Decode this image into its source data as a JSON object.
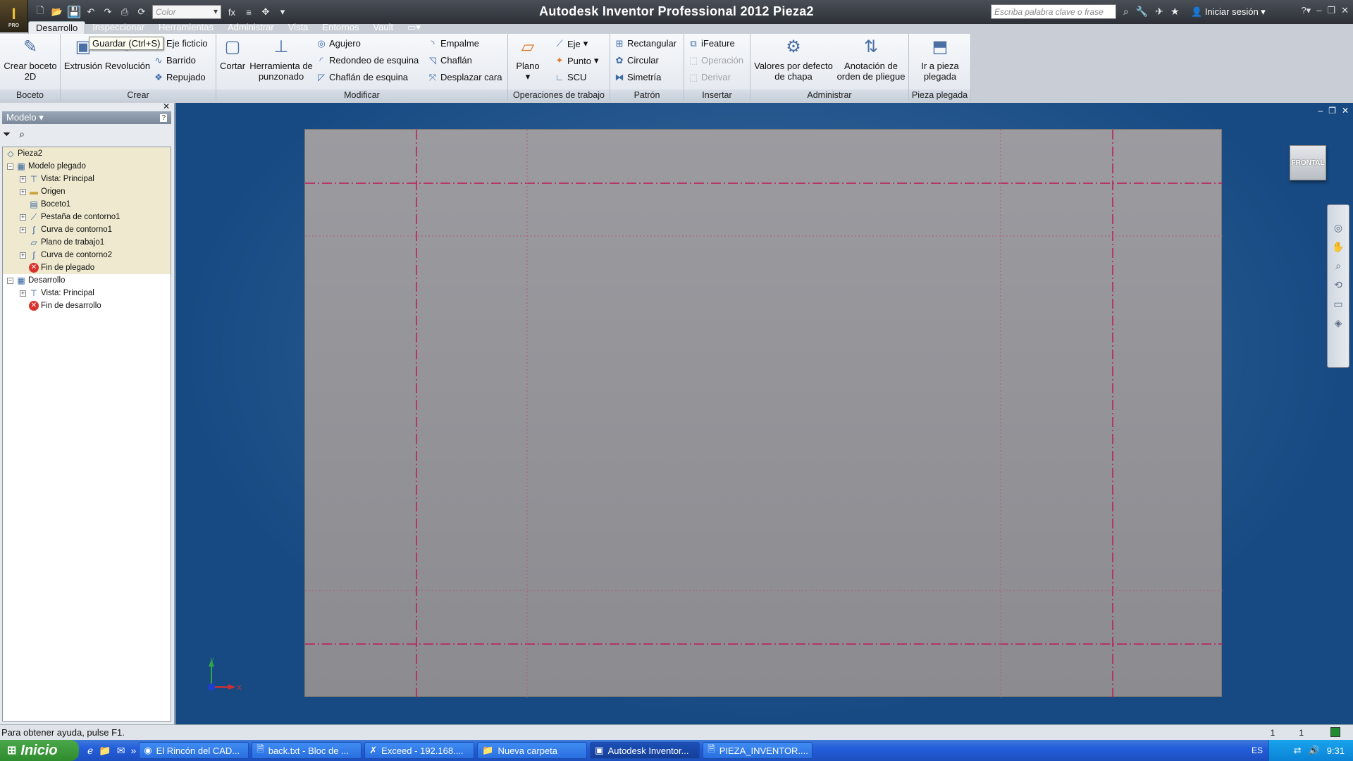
{
  "window": {
    "title": "Autodesk Inventor Professional 2012    Pieza2"
  },
  "app_button": {
    "letter": "I",
    "badge": "PRO"
  },
  "qat": {
    "color_combo": "Color",
    "fx_label": "fx"
  },
  "help": {
    "search_placeholder": "Escriba palabra clave o frase",
    "signin": "Iniciar sesión"
  },
  "menu": {
    "tabs": [
      "Desarrollo",
      "Inspeccionar",
      "Herramientas",
      "Administrar",
      "Vista",
      "Entornos",
      "Vault"
    ]
  },
  "tooltip": "Guardar (Ctrl+S)",
  "ribbon": {
    "boceto": {
      "title": "Boceto",
      "create_sketch": "Crear boceto 2D"
    },
    "crear": {
      "title": "Crear",
      "extrusion": "Extrusión",
      "revolucion": "Revolución",
      "eje_ficticio": "Eje ficticio",
      "barrido": "Barrido",
      "repujado": "Repujado"
    },
    "modificar": {
      "title": "Modificar",
      "cortar": "Cortar",
      "punzonado": "Herramienta de punzonado",
      "agujero": "Agujero",
      "redondeo": "Redondeo de esquina",
      "chaflan_esquina": "Chaflán de esquina",
      "empalme": "Empalme",
      "chaflan": "Chaflán",
      "desplazar": "Desplazar cara"
    },
    "operaciones": {
      "title": "Operaciones de trabajo",
      "plano": "Plano",
      "eje": "Eje",
      "punto": "Punto",
      "scu": "SCU"
    },
    "patron": {
      "title": "Patrón",
      "rectangular": "Rectangular",
      "circular": "Circular",
      "simetria": "Simetría"
    },
    "insertar": {
      "title": "Insertar",
      "ifeature": "iFeature",
      "operacion": "Operación",
      "derivar": "Derivar"
    },
    "administrar": {
      "title": "Administrar",
      "valores": "Valores por defecto de chapa",
      "anotacion": "Anotación de orden de pliegue"
    },
    "pieza_plegada": {
      "title": "Pieza plegada",
      "ir": "Ir a pieza plegada"
    }
  },
  "browser": {
    "header": "Modelo ▾",
    "tree": [
      {
        "label": "Pieza2"
      },
      {
        "label": "Modelo plegado"
      },
      {
        "label": "Vista: Principal"
      },
      {
        "label": "Origen"
      },
      {
        "label": "Boceto1"
      },
      {
        "label": "Pestaña de contorno1"
      },
      {
        "label": "Curva de contorno1"
      },
      {
        "label": "Plano de trabajo1"
      },
      {
        "label": "Curva de contorno2"
      },
      {
        "label": "Fin de plegado"
      },
      {
        "label": "Desarrollo"
      },
      {
        "label": "Vista: Principal"
      },
      {
        "label": "Fin de desarrollo"
      }
    ]
  },
  "viewport": {
    "viewcube_label": "FRONTAL",
    "axis_x": "X",
    "axis_y": "Y",
    "bend_line_color": "#c0185a",
    "part_color": "#919196"
  },
  "status": {
    "text": "Para obtener ayuda, pulse F1.",
    "num1": "1",
    "num2": "1"
  },
  "taskbar": {
    "start": "Inicio",
    "tasks": [
      "El Rincón del CAD...",
      "back.txt - Bloc de ...",
      "Exceed - 192.168....",
      "Nueva carpeta",
      "Autodesk Inventor...",
      "PIEZA_INVENTOR...."
    ],
    "lang": "ES",
    "time": "9:31"
  }
}
